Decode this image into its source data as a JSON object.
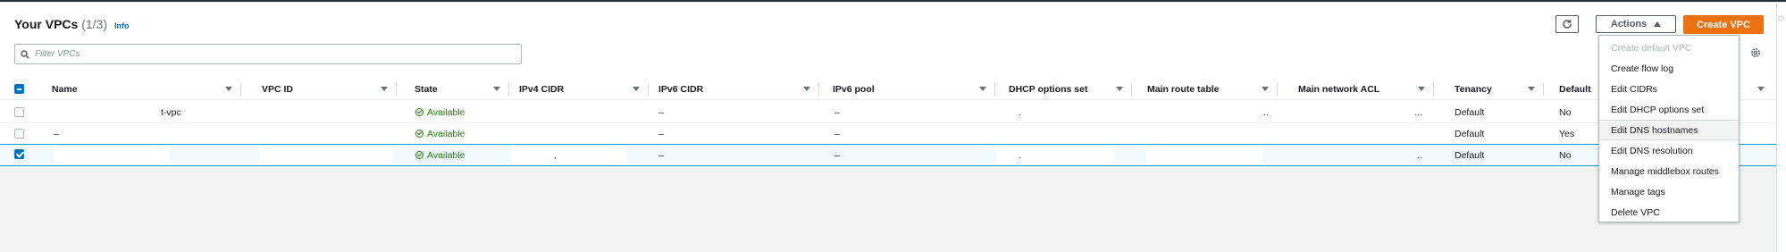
{
  "header": {
    "title": "Your VPCs",
    "count": "(1/3)",
    "info": "Info",
    "actions_label": "Actions",
    "create_label": "Create VPC"
  },
  "search": {
    "placeholder": "Filter VPCs"
  },
  "table": {
    "columns": [
      "Name",
      "VPC ID",
      "State",
      "IPv4 CIDR",
      "IPv6 CIDR",
      "IPv6 pool",
      "DHCP options set",
      "Main route table",
      "Main network ACL",
      "Tenancy",
      "Default"
    ],
    "rows": [
      {
        "name": "t-vpc",
        "name_prefix": "",
        "state": "Available",
        "ipv6_cidr": "–",
        "ipv6_pool": "–",
        "dhcp": ".",
        "route": "..",
        "acl": "...",
        "tenancy": "Default",
        "default": "No",
        "selected": false
      },
      {
        "name": "",
        "name_prefix": "–",
        "state": "Available",
        "ipv6_cidr": "–",
        "ipv6_pool": "–",
        "dhcp": "",
        "route": "",
        "acl": "",
        "tenancy": "Default",
        "default": "Yes",
        "selected": false
      },
      {
        "name": "",
        "name_prefix": "",
        "state": "Available",
        "ipv4_trail": ",",
        "ipv6_cidr": "–",
        "ipv6_pool": "–",
        "dhcp": ".",
        "route": "",
        "acl": "..",
        "tenancy": "Default",
        "default": "No",
        "selected": true
      }
    ]
  },
  "actions_menu": [
    {
      "label": "Create default VPC",
      "disabled": true
    },
    {
      "label": "Create flow log"
    },
    {
      "label": "Edit CIDRs"
    },
    {
      "label": "Edit DHCP options set"
    },
    {
      "label": "Edit DNS hostnames",
      "hover": true
    },
    {
      "label": "Edit DNS resolution"
    },
    {
      "label": "Manage middlebox routes"
    },
    {
      "label": "Manage tags"
    },
    {
      "label": "Delete VPC"
    }
  ],
  "colors": {
    "accent": "#ec7211",
    "link": "#0073bb",
    "available": "#1d8102"
  }
}
